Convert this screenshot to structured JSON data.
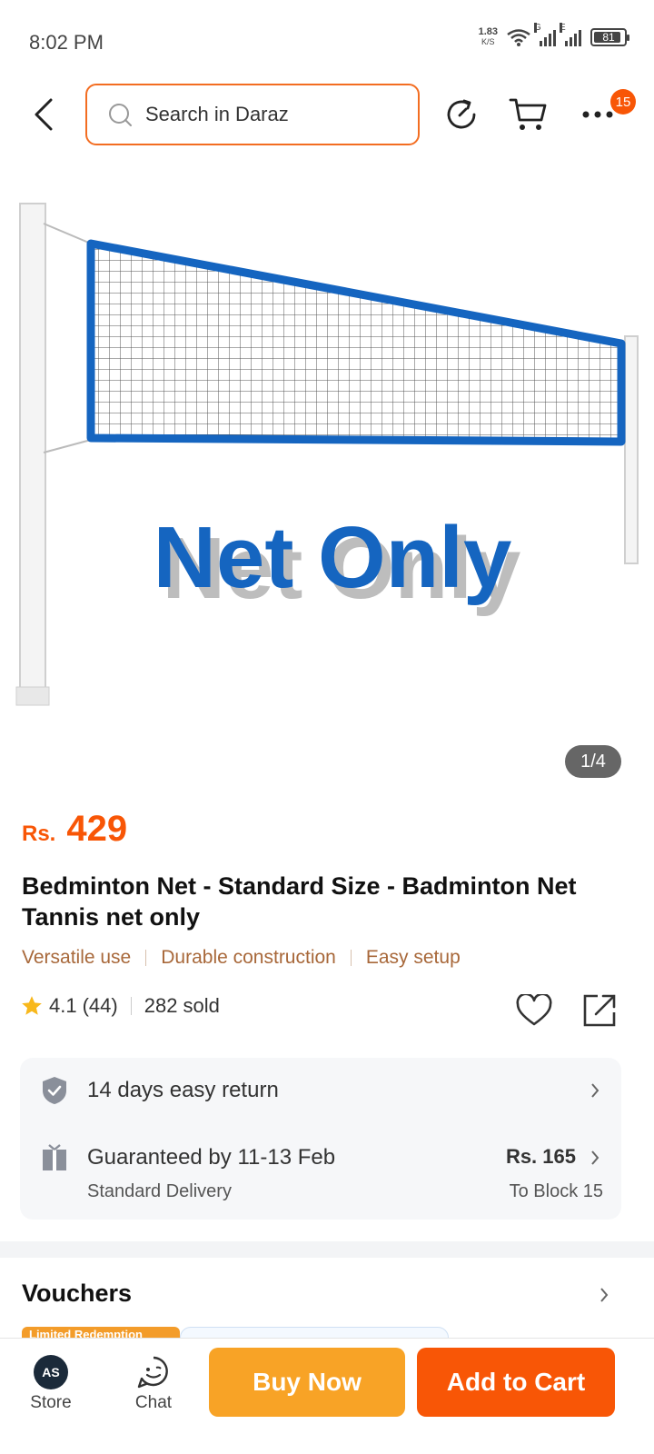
{
  "status_bar": {
    "time": "8:02 PM",
    "net_speed_value": "1.83",
    "net_speed_unit": "K/S",
    "sim1_label": "G",
    "sim2_label": "E",
    "battery": "81"
  },
  "header": {
    "search_placeholder": "Search in Daraz",
    "more_badge": "15"
  },
  "gallery": {
    "image_caption": "Net Only",
    "page_indicator": "1/4"
  },
  "product": {
    "currency": "Rs.",
    "price": "429",
    "title": "Bedminton Net - Standard Size - Badminton Net Tannis net only",
    "tags": [
      "Versatile use",
      "Durable construction",
      "Easy setup"
    ],
    "rating": "4.1",
    "rating_count": "(44)",
    "sold": "282 sold"
  },
  "services": {
    "return_text": "14 days easy return",
    "delivery_text": "Guaranteed by 11-13 Feb",
    "delivery_type": "Standard Delivery",
    "delivery_fee": "Rs. 165",
    "delivery_location": "To Block 15"
  },
  "vouchers": {
    "title": "Vouchers",
    "tag": "Limited Redemption"
  },
  "bottom_bar": {
    "store_label": "Store",
    "store_logo_text": "AS",
    "chat_label": "Chat",
    "buy_now": "Buy Now",
    "add_to_cart": "Add to Cart"
  },
  "colors": {
    "brand_orange": "#f85606",
    "buy_now": "#f8a326",
    "search_border": "#f36d21",
    "net_blue": "#1565c0",
    "tag_brown": "#a8683a"
  }
}
